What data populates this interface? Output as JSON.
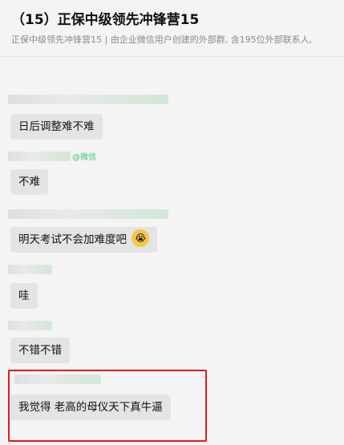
{
  "header": {
    "title": "（15）正保中级领先冲锋营15",
    "subtitle": "正保中级领先冲锋营15 | 由企业微信用户创建的外部群, 含195位外部联系人,"
  },
  "messages": [
    {
      "text": "日后调整难不难"
    },
    {
      "text": "不难",
      "sender_tag": "@微信"
    },
    {
      "text": "明天考试不会加难度吧"
    },
    {
      "text": "哇"
    },
    {
      "text": "不错不错"
    },
    {
      "text": "我觉得  老高的母仪天下真牛逼"
    }
  ],
  "colors": {
    "highlight_border": "#e5191c",
    "bubble_bg": "#e4e4e4",
    "wechat_green": "#3bbf6f"
  },
  "icons": {
    "emoji": "crying-face-emoji"
  }
}
